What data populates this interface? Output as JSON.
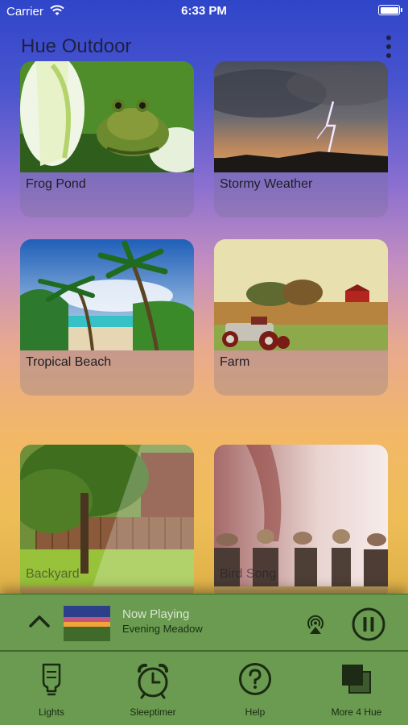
{
  "status_bar": {
    "carrier": "Carrier",
    "time": "6:33 PM"
  },
  "header": {
    "title": "Hue Outdoor"
  },
  "scenes": [
    {
      "label": "Frog Pond"
    },
    {
      "label": "Stormy Weather"
    },
    {
      "label": "Tropical Beach"
    },
    {
      "label": "Farm"
    },
    {
      "label": "Backyard"
    },
    {
      "label": "Bird Song"
    }
  ],
  "now_playing": {
    "status": "Now Playing",
    "track": "Evening Meadow"
  },
  "tabs": [
    {
      "label": "Lights"
    },
    {
      "label": "Sleeptimer"
    },
    {
      "label": "Help"
    },
    {
      "label": "More 4 Hue"
    }
  ],
  "colors": {
    "bar_green": "#6a9b51",
    "title": "#1e2142"
  }
}
